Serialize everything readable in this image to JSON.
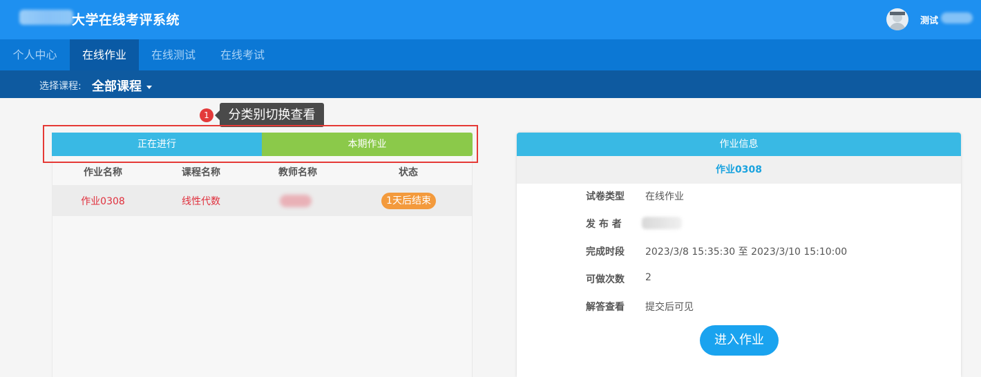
{
  "header": {
    "system_title": "大学在线考评系统",
    "user_name": "测试"
  },
  "nav": {
    "items": [
      {
        "label": "个人中心"
      },
      {
        "label": "在线作业"
      },
      {
        "label": "在线测试"
      },
      {
        "label": "在线考试"
      }
    ],
    "active_index": 1
  },
  "course_filter": {
    "label": "选择课程:",
    "selected": "全部课程"
  },
  "annotation": {
    "number": "1",
    "text": "分类别切换查看"
  },
  "tabs": [
    {
      "label": "正在进行"
    },
    {
      "label": "本期作业"
    }
  ],
  "table": {
    "columns": [
      "作业名称",
      "课程名称",
      "教师名称",
      "状态"
    ],
    "rows": [
      {
        "name": "作业0308",
        "course": "线性代数",
        "status": "1天后结束"
      }
    ]
  },
  "detail": {
    "header": "作业信息",
    "title": "作业0308",
    "fields": [
      {
        "label": "试卷类型",
        "value": "在线作业"
      },
      {
        "label": "发 布 者",
        "value": ""
      },
      {
        "label": "完成时段",
        "value": "2023/3/8 15:35:30 至 2023/3/10 15:10:00"
      },
      {
        "label": "可做次数",
        "value": "2"
      },
      {
        "label": "解答查看",
        "value": "提交后可见"
      }
    ],
    "enter_button": "进入作业"
  },
  "colors": {
    "header_bg": "#1e90f0",
    "nav_bg": "#0c78d5",
    "course_bar_bg": "#0e5aa0",
    "tab_ongoing": "#39b9e4",
    "tab_current": "#8bc94a",
    "status_badge": "#f39a3c",
    "highlight_border": "#e53935",
    "button": "#1aa3ef"
  }
}
